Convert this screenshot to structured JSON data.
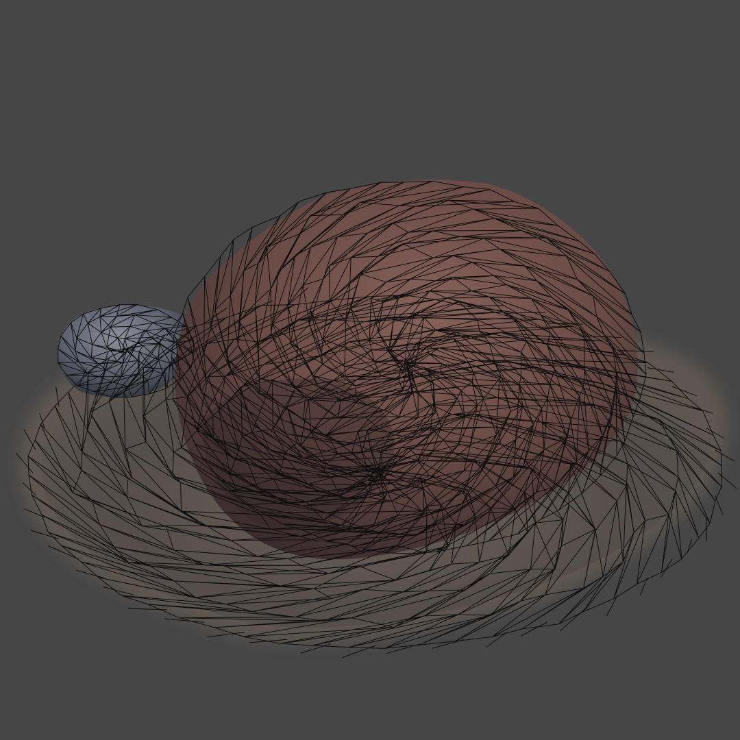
{
  "viewport": {
    "background_color": "#464646",
    "render_mode": "textured-wireframe"
  },
  "model": {
    "subject": "rock",
    "objects": [
      "large-boulder",
      "small-rock",
      "ground-patch"
    ],
    "colors": {
      "large_boulder": "#6e5049",
      "small_rock": "#5c6270",
      "ground": "#6a6158",
      "wireframe": "#0d0d0d"
    }
  }
}
